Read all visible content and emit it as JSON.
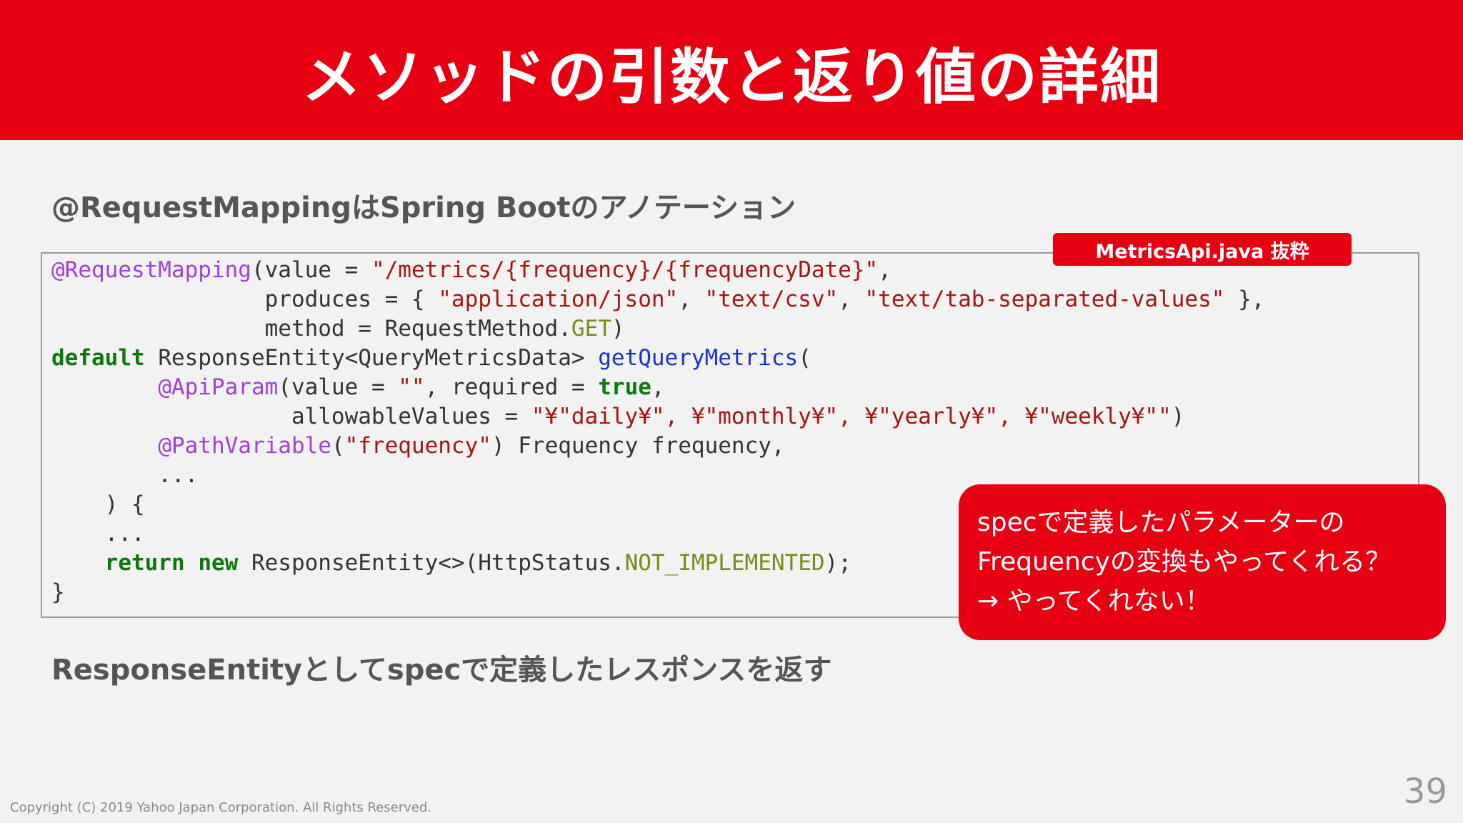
{
  "title": "メソッドの引数と返り値の詳細",
  "subtitle": "@RequestMappingはSpring Bootのアノテーション",
  "file_badge": "MetricsApi.java 抜粋",
  "code_lines": [
    [
      {
        "t": "ann",
        "v": "@RequestMapping"
      },
      {
        "t": "plain",
        "v": "(value = "
      },
      {
        "t": "str",
        "v": "\"/metrics/{frequency}/{frequencyDate}\""
      },
      {
        "t": "plain",
        "v": ","
      }
    ],
    [
      {
        "t": "plain",
        "v": "                produces = { "
      },
      {
        "t": "str",
        "v": "\"application/json\""
      },
      {
        "t": "plain",
        "v": ", "
      },
      {
        "t": "str",
        "v": "\"text/csv\""
      },
      {
        "t": "plain",
        "v": ", "
      },
      {
        "t": "str",
        "v": "\"text/tab-separated-values\""
      },
      {
        "t": "plain",
        "v": " },"
      }
    ],
    [
      {
        "t": "plain",
        "v": "                method = RequestMethod."
      },
      {
        "t": "const",
        "v": "GET"
      },
      {
        "t": "plain",
        "v": ")"
      }
    ],
    [
      {
        "t": "kw",
        "v": "default"
      },
      {
        "t": "plain",
        "v": " ResponseEntity<QueryMetricsData> "
      },
      {
        "t": "fn",
        "v": "getQueryMetrics"
      },
      {
        "t": "plain",
        "v": "("
      }
    ],
    [
      {
        "t": "plain",
        "v": "        "
      },
      {
        "t": "ann",
        "v": "@ApiParam"
      },
      {
        "t": "plain",
        "v": "(value = "
      },
      {
        "t": "str",
        "v": "\"\""
      },
      {
        "t": "plain",
        "v": ", required = "
      },
      {
        "t": "kw",
        "v": "true"
      },
      {
        "t": "plain",
        "v": ","
      }
    ],
    [
      {
        "t": "plain",
        "v": "                  allowableValues = "
      },
      {
        "t": "str",
        "v": "\"¥\"daily¥\", ¥\"monthly¥\", ¥\"yearly¥\", ¥\"weekly¥\"\""
      },
      {
        "t": "plain",
        "v": ")"
      }
    ],
    [
      {
        "t": "plain",
        "v": "        "
      },
      {
        "t": "ann",
        "v": "@PathVariable"
      },
      {
        "t": "plain",
        "v": "("
      },
      {
        "t": "str",
        "v": "\"frequency\""
      },
      {
        "t": "plain",
        "v": ") Frequency frequency,"
      }
    ],
    [
      {
        "t": "plain",
        "v": "        ..."
      }
    ],
    [
      {
        "t": "plain",
        "v": "    ) {"
      }
    ],
    [
      {
        "t": "plain",
        "v": "    ..."
      }
    ],
    [
      {
        "t": "plain",
        "v": "    "
      },
      {
        "t": "kw",
        "v": "return"
      },
      {
        "t": "plain",
        "v": " "
      },
      {
        "t": "kw",
        "v": "new"
      },
      {
        "t": "plain",
        "v": " ResponseEntity<>(HttpStatus."
      },
      {
        "t": "const",
        "v": "NOT_IMPLEMENTED"
      },
      {
        "t": "plain",
        "v": ");"
      }
    ],
    [
      {
        "t": "plain",
        "v": "}"
      }
    ]
  ],
  "callout": {
    "line1": "specで定義したパラメーターの",
    "line2": "Frequencyの変換もやってくれる？",
    "line3": "→ やってくれない！"
  },
  "bottom_text": "ResponseEntityとしてspecで定義したレスポンスを返す",
  "copyright": "Copyright (C) 2019 Yahoo Japan Corporation. All Rights Reserved.",
  "page_number": "39",
  "colors": {
    "brand_red": "#e60012",
    "annotation": "#a23fd6",
    "string": "#a31515",
    "keyword": "#0b7a0b",
    "function": "#1a2fd6",
    "constant": "#7a8a1a"
  }
}
